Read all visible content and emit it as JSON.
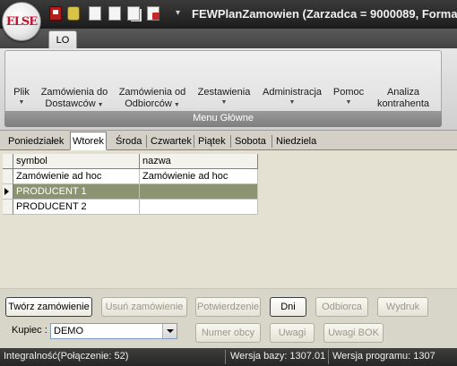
{
  "window": {
    "title": "FEWPlanZamowien (Zarzadca = 9000089, Forma",
    "logo_text": "ELSE"
  },
  "quick_access": {
    "icons": [
      "save-icon",
      "settings-icon",
      "document-icon",
      "copy-icon",
      "pages-icon",
      "print-icon"
    ],
    "more": "▾"
  },
  "ribbon": {
    "active_tab": "LO",
    "group_label": "Menu Główne",
    "buttons": [
      {
        "line1": "Plik",
        "line2": ""
      },
      {
        "line1": "Zamówienia do",
        "line2": "Dostawców"
      },
      {
        "line1": "Zamówienia od",
        "line2": "Odbiorców"
      },
      {
        "line1": "Zestawienia",
        "line2": ""
      },
      {
        "line1": "Administracja",
        "line2": ""
      },
      {
        "line1": "Pomoc",
        "line2": ""
      },
      {
        "line1": "Analiza",
        "line2": "kontrahenta"
      }
    ]
  },
  "day_tabs": {
    "items": [
      "Poniedziałek",
      "Wtorek",
      "Środa",
      "Czwartek",
      "Piątek",
      "Sobota",
      "Niedziela"
    ],
    "active": "Wtorek"
  },
  "grid": {
    "columns": [
      "symbol",
      "nazwa"
    ],
    "rows": [
      {
        "symbol": "Zamówienie ad hoc",
        "nazwa": "Zamówienie ad hoc",
        "selected": false
      },
      {
        "symbol": "PRODUCENT 1",
        "nazwa": "",
        "selected": true
      },
      {
        "symbol": "PRODUCENT 2",
        "nazwa": "",
        "selected": false
      }
    ]
  },
  "actions": {
    "create_order": "Twórz zamówienie",
    "delete_order": "Usuń zamówienie",
    "confirm": "Potwierdzenie",
    "days": "Dni",
    "recipient": "Odbiorca",
    "print": "Wydruk",
    "foreign_number": "Numer obcy",
    "notes": "Uwagi",
    "notes_bok": "Uwagi BOK"
  },
  "buyer": {
    "label": "Kupiec :",
    "value": "DEMO"
  },
  "status_bar": {
    "integrity": "Integralność(Połączenie: 52)",
    "db_version": "Wersja bazy: 1307.01",
    "app_version": "Wersja programu: 1307"
  },
  "colors": {
    "selected_row": "#8a9470",
    "titlebar": "#262626",
    "logo_red": "#c8102e"
  }
}
